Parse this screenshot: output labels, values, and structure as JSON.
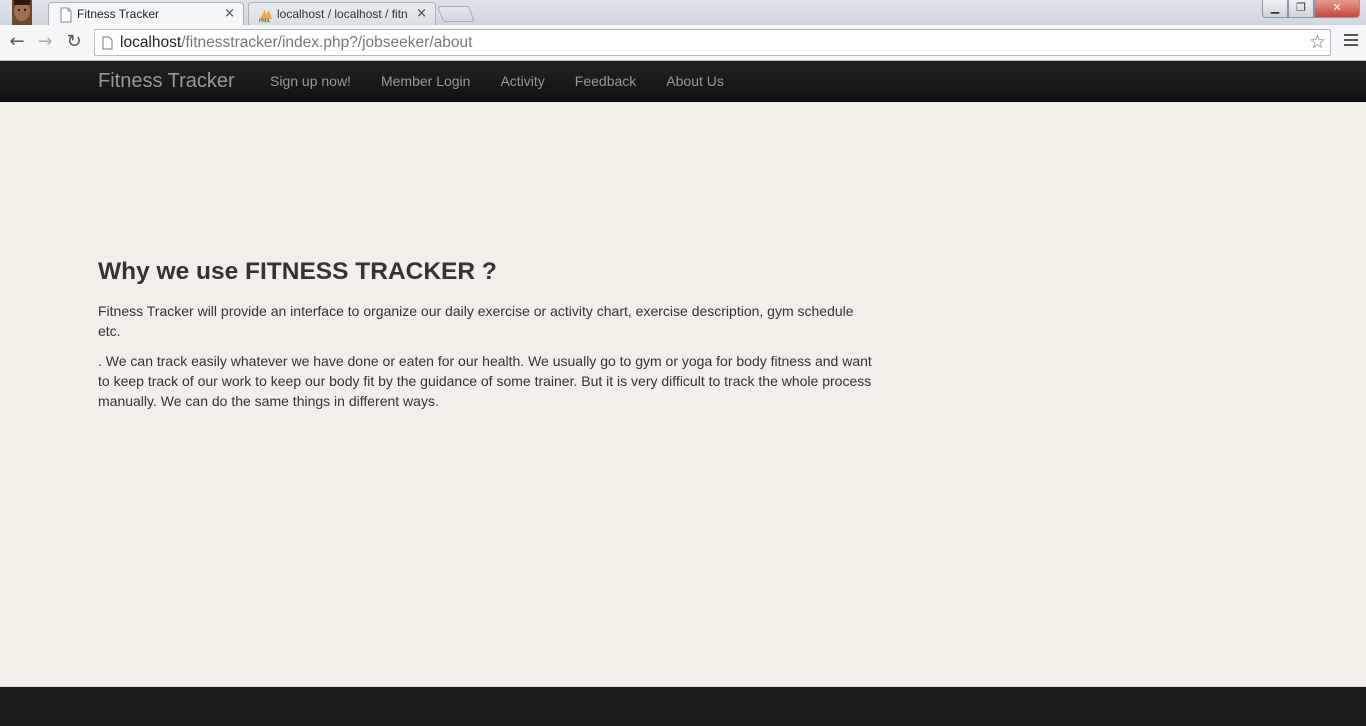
{
  "browser": {
    "tabs": [
      {
        "title": "Fitness Tracker",
        "active": true
      },
      {
        "title": "localhost / localhost / fitn",
        "active": false
      }
    ],
    "url": {
      "host": "localhost",
      "path": "/fitnesstracker/index.php?/jobseeker/about"
    },
    "icons": {
      "back": "back-arrow-icon",
      "forward": "forward-arrow-icon",
      "reload": "reload-icon",
      "bookmark": "star-icon",
      "menu": "hamburger-menu-icon"
    }
  },
  "navbar": {
    "brand": "Fitness Tracker",
    "links": [
      "Sign up now!",
      "Member Login",
      "Activity",
      "Feedback",
      "About Us"
    ]
  },
  "main": {
    "heading": "Why we use FITNESS TRACKER ?",
    "paragraphs": [
      "Fitness Tracker will provide an interface to organize our daily exercise or activity chart, exercise description, gym schedule etc.",
      ". We can track easily whatever we have done or eaten for our health. We usually go to gym or yoga for body fitness and want to keep track of our work to keep our body fit by the guidance of some trainer. But it is very difficult to track the whole process manually. We can do the same things in different ways."
    ]
  },
  "colors": {
    "navbar_bg": "#1b1b1b",
    "page_bg": "#f2efe9",
    "nav_text": "#999999",
    "body_text": "#333333"
  }
}
